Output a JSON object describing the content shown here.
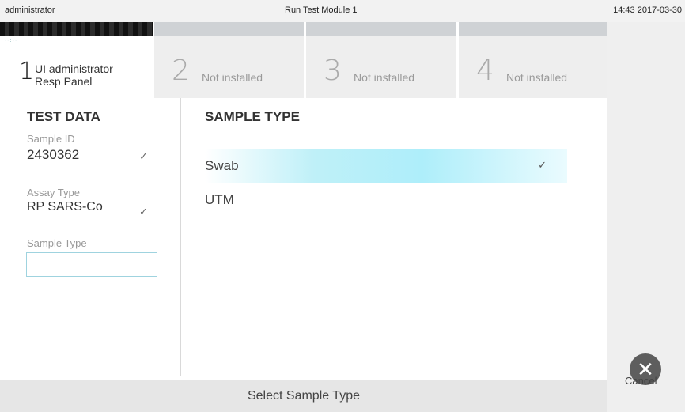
{
  "topbar": {
    "user": "administrator",
    "title": "Run Test Module 1",
    "clock": "14:43 2017-03-30"
  },
  "tabs": [
    {
      "num": "1",
      "label_line1": "UI administrator",
      "label_line2": "Resp Panel",
      "mini": "--:--"
    },
    {
      "num": "2",
      "label": "Not installed"
    },
    {
      "num": "3",
      "label": "Not installed"
    },
    {
      "num": "4",
      "label": "Not installed"
    }
  ],
  "test_data": {
    "title": "TEST DATA",
    "sample_id_label": "Sample ID",
    "sample_id_value": "2430362",
    "assay_type_label": "Assay Type",
    "assay_type_value": "RP SARS-Co",
    "sample_type_label": "Sample Type",
    "sample_type_value": ""
  },
  "sample_type": {
    "title": "SAMPLE TYPE",
    "options": [
      {
        "label": "Swab",
        "selected": true
      },
      {
        "label": "UTM",
        "selected": false
      }
    ]
  },
  "cancel_label": "Cancel",
  "footer": "Select Sample Type"
}
